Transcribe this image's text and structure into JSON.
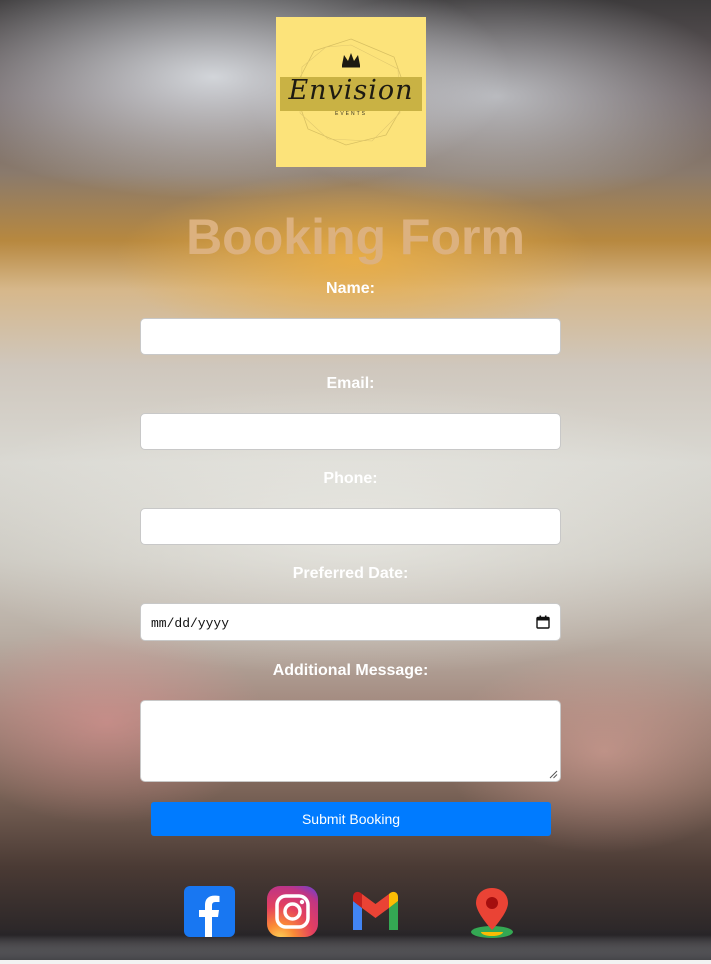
{
  "logo": {
    "brand_text": "Envision",
    "sub_text": "EVENTS"
  },
  "form": {
    "title": "Booking Form",
    "fields": [
      {
        "label": "Name:",
        "value": ""
      },
      {
        "label": "Email:",
        "value": ""
      },
      {
        "label": "Phone:",
        "value": ""
      },
      {
        "label": "Preferred Date:",
        "value": "",
        "placeholder": "mm/dd/yyyy"
      },
      {
        "label": "Additional Message:",
        "value": ""
      }
    ],
    "submit_label": "Submit Booking"
  },
  "social": [
    {
      "name": "facebook",
      "icon": "facebook-icon",
      "color": "#1877f2"
    },
    {
      "name": "instagram",
      "icon": "instagram-icon",
      "color": "#e4405f"
    },
    {
      "name": "gmail",
      "icon": "gmail-icon",
      "color": "#ea4335"
    },
    {
      "name": "maps",
      "icon": "map-pin-icon",
      "color": "#ea4335"
    }
  ],
  "colors": {
    "title": "#dcb17f",
    "button": "#007bff",
    "logo_bg": "#fce37a"
  }
}
